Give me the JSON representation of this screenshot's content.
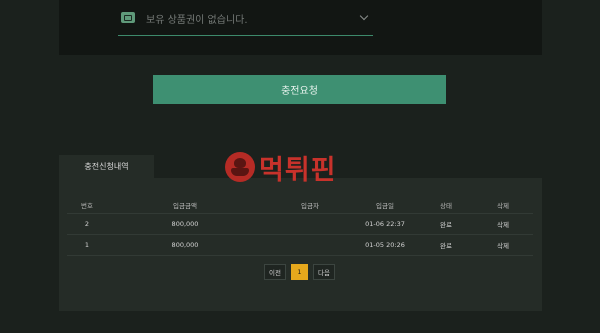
{
  "voucher": {
    "placeholder": "보유 상품권이 없습니다.",
    "icon": "ticket-icon"
  },
  "charge_button_label": "충전요청",
  "history_tab_label": "충전신청내역",
  "watermark_text": "먹튀핀",
  "table": {
    "headers": [
      "번호",
      "입금금액",
      "입금자",
      "입금일",
      "상태",
      "삭제"
    ],
    "rows": [
      {
        "num": "2",
        "amount": "800,000",
        "name": "",
        "date": "01-06 22:37",
        "status": "완료",
        "delete": "삭제"
      },
      {
        "num": "1",
        "amount": "800,000",
        "name": "",
        "date": "01-05 20:26",
        "status": "완료",
        "delete": "삭제"
      }
    ]
  },
  "pagination": {
    "prev": "이전",
    "current": "1",
    "next": "다음"
  },
  "colors": {
    "accent": "#3e9072",
    "page_current": "#e6a81c",
    "background": "#1b211d"
  }
}
